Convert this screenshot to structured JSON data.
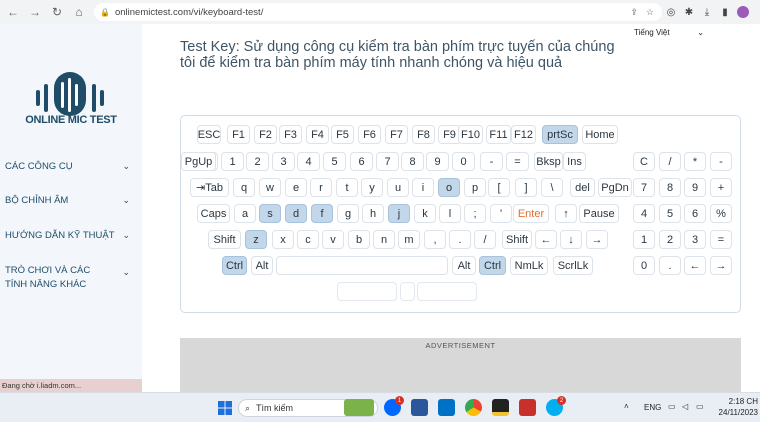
{
  "browser": {
    "url": "onlinemictest.com/vi/keyboard-test/",
    "nav_icons": [
      "back-icon",
      "forward-icon",
      "reload-icon",
      "home-icon"
    ],
    "ext_icons": [
      "share-icon",
      "star-icon",
      "opera-icon",
      "puzzle-icon",
      "download-icon",
      "sidepanel-icon",
      "profile-icon"
    ]
  },
  "sidebar": {
    "brand": "ONLINE MIC TEST",
    "items": [
      {
        "label": "CÁC CÔNG CỤ"
      },
      {
        "label": "BỘ CHỈNH ÂM"
      },
      {
        "label": "HƯỚNG DẪN KỸ THUẬT"
      },
      {
        "label": "TRÒ CHƠI VÀ CÁC TÍNH NĂNG KHÁC"
      }
    ]
  },
  "status_text": "Đang chờ i.liadm.com...",
  "main": {
    "lang": "Tiếng Việt",
    "title": "Test Key: Sử dụng công cụ kiểm tra bàn phím trực tuyến của chúng tôi để kiểm tra bàn phím máy tính nhanh chóng và hiệu quả",
    "ad_label": "ADVERTISEMENT"
  },
  "keyboard": {
    "rows": [
      [
        "ESC",
        "F1",
        "F2",
        "F3",
        "F4",
        "F5",
        "F6",
        "F7",
        "F8",
        "F9",
        "F10",
        "F11",
        "F12",
        "prtSc",
        "Home"
      ],
      [
        "`",
        "1",
        "2",
        "3",
        "4",
        "5",
        "6",
        "7",
        "8",
        "9",
        "0",
        "-",
        "=",
        "Bksp",
        "Ins",
        "PgUp"
      ],
      [
        "⇥Tab",
        "q",
        "w",
        "e",
        "r",
        "t",
        "y",
        "u",
        "i",
        "o",
        "p",
        "[",
        "]",
        "\\",
        "del",
        "PgDn"
      ],
      [
        "Caps",
        "a",
        "s",
        "d",
        "f",
        "g",
        "h",
        "j",
        "k",
        "l",
        ";",
        "'",
        "Enter",
        "↑",
        "Pause"
      ],
      [
        "Shift",
        "z",
        "x",
        "c",
        "v",
        "b",
        "n",
        "m",
        ",",
        ".",
        "/",
        "Shift",
        "←",
        "↓",
        "→"
      ],
      [
        "Ctrl",
        "Alt",
        "",
        "Alt",
        "Ctrl",
        "NmLk",
        "ScrlLk"
      ]
    ],
    "numpad": [
      [
        "C",
        "/",
        "*",
        "-"
      ],
      [
        "7",
        "8",
        "9",
        "+"
      ],
      [
        "4",
        "5",
        "6",
        "%"
      ],
      [
        "1",
        "2",
        "3",
        "="
      ],
      [
        "0",
        ".",
        "←",
        "→"
      ]
    ],
    "highlighted": [
      "prtSc",
      "o",
      "s",
      "d",
      "f",
      "j",
      "z",
      "Ctrl"
    ],
    "accent_color": "#c3d7ea",
    "enter_color": "#e07030"
  },
  "taskbar": {
    "search_placeholder": "Tìm kiếm",
    "badges": {
      "zalo": "1",
      "skype": "2"
    },
    "lang": "ENG",
    "time": "2:18 CH",
    "date": "24/11/2023"
  }
}
